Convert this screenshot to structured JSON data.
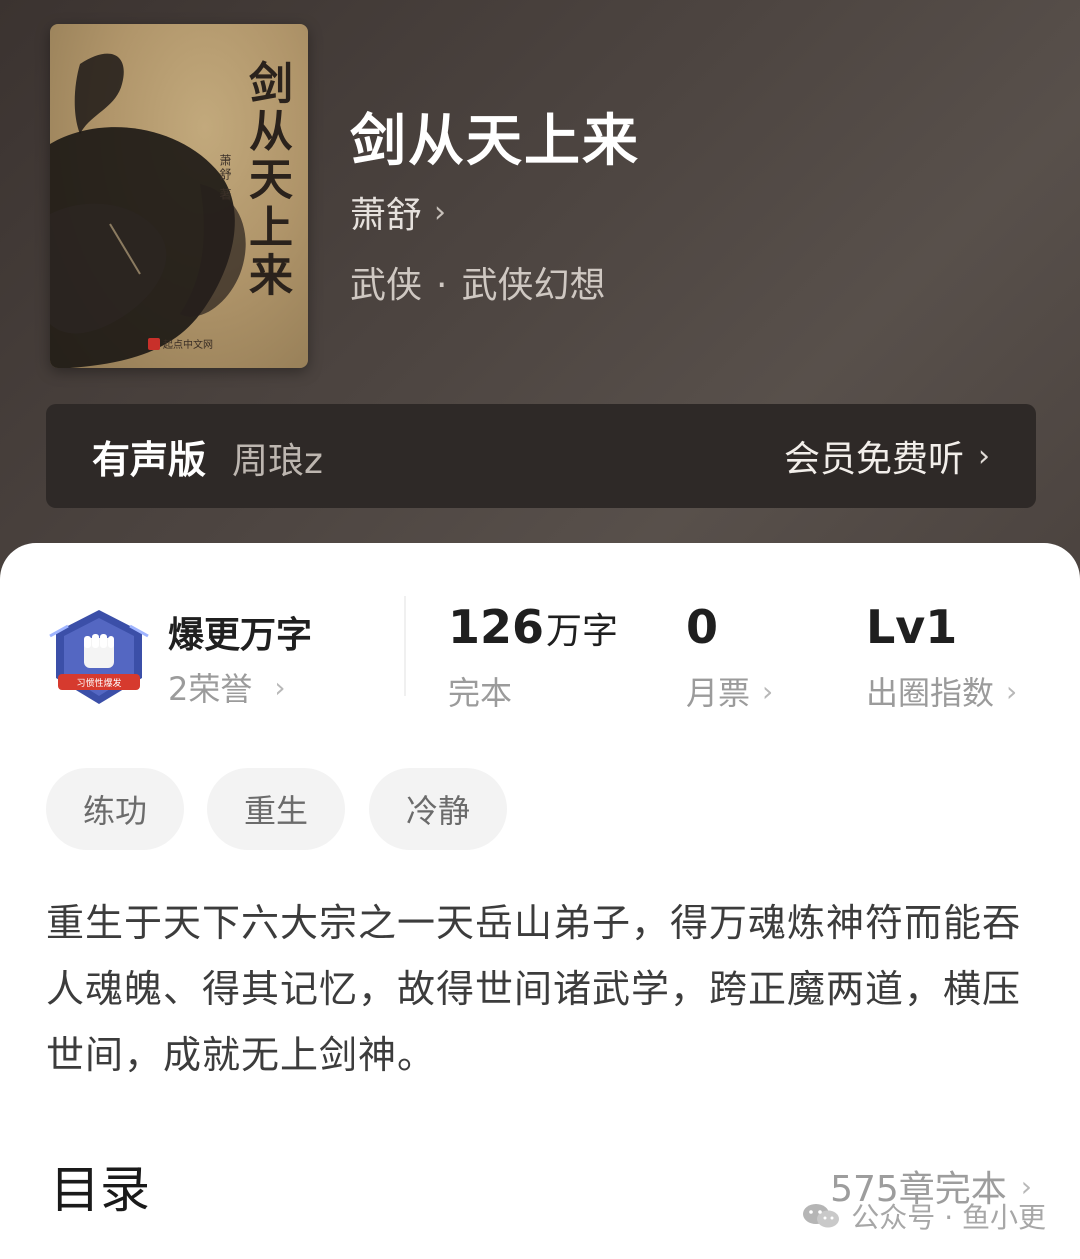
{
  "book": {
    "title": "剑从天上来",
    "author": "萧舒",
    "genre": "武侠",
    "subgenre": "武侠幻想",
    "cover": {
      "title": "剑从天上来",
      "author_text": "萧舒 著",
      "publisher": "起点中文网"
    }
  },
  "audio": {
    "label": "有声版",
    "narrator": "周琅z",
    "action": "会员免费听"
  },
  "honor": {
    "title": "爆更万字",
    "sub": "2荣誉",
    "badge_text": "习惯性爆发"
  },
  "stats": {
    "words_value": "126",
    "words_unit": "万字",
    "words_label": "完本",
    "tickets_value": "0",
    "tickets_label": "月票",
    "level_value": "Lv1",
    "level_label": "出圈指数"
  },
  "tags": [
    "练功",
    "重生",
    "冷静"
  ],
  "synopsis": "重生于天下六大宗之一天岳山弟子，得万魂炼神符而能吞人魂魄、得其记忆，故得世间诸武学，跨正魔两道，横压世间，成就无上剑神。",
  "toc": {
    "title": "目录",
    "summary": "575章完本"
  },
  "watermark": {
    "text": "公众号 · 鱼小更"
  },
  "icons": {
    "chevron": "chevron-right-icon",
    "badge": "fist-badge-icon",
    "watermark": "wechat-icon"
  },
  "colors": {
    "header_bg": "#4a423e",
    "audio_bar": "#2e2927",
    "badge_blue": "#3b4fa8",
    "seal_red": "#c8302a"
  }
}
